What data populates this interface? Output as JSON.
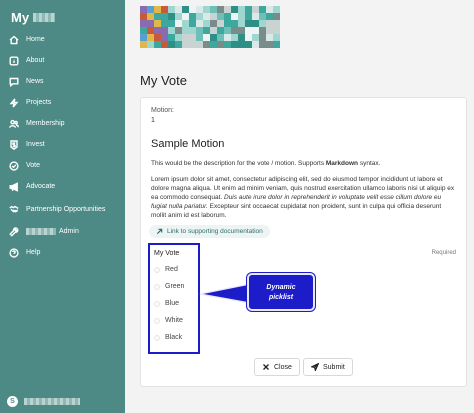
{
  "sidebar": {
    "brand": "My",
    "items": [
      {
        "label": "Home",
        "icon": "home-icon"
      },
      {
        "label": "About",
        "icon": "info-icon"
      },
      {
        "label": "News",
        "icon": "news-icon"
      },
      {
        "label": "Projects",
        "icon": "projects-icon"
      },
      {
        "label": "Membership",
        "icon": "users-icon"
      },
      {
        "label": "Invest",
        "icon": "dollar-icon"
      },
      {
        "label": "Vote",
        "icon": "check-circle-icon"
      },
      {
        "label": "Advocate",
        "icon": "megaphone-icon"
      },
      {
        "label": "Partnership Opportunities",
        "icon": "handshake-icon"
      },
      {
        "label": "Admin",
        "icon": "wrench-icon"
      },
      {
        "label": "Help",
        "icon": "help-icon"
      }
    ],
    "user_initial": "S"
  },
  "page": {
    "title": "My Vote"
  },
  "motion": {
    "label": "Motion:",
    "number": "1",
    "title": "Sample Motion",
    "desc_before": "This would be the description for the vote / motion. Supports ",
    "desc_bold": "Markdown",
    "desc_after": " syntax.",
    "lorem_plain": "Lorem ipsum dolor sit amet, consectetur adipiscing elit, sed do eiusmod tempor incididunt ut labore et dolore magna aliqua. Ut enim ad minim veniam, quis nostrud exercitation ullamco laboris nisi ut aliquip ex ea commodo consequat. ",
    "lorem_italic": "Duis aute irure dolor in reprehenderit in voluptate velit esse cillum dolore eu fugiat nulla pariatur.",
    "lorem_end": " Excepteur sint occaecat cupidatat non proident, sunt in culpa qui officia deserunt mollit anim id est laborum.",
    "doc_link": "Link to supporting documentation"
  },
  "vote": {
    "title": "My Vote",
    "required": "Required",
    "options": [
      "Red",
      "Green",
      "Blue",
      "White",
      "Black"
    ]
  },
  "buttons": {
    "close": "Close",
    "submit": "Submit"
  },
  "annotation": {
    "line1": "Dynamic",
    "line2": "picklist"
  },
  "colors": {
    "sidebar": "#4d8a86",
    "highlight": "#1c1cc9"
  }
}
